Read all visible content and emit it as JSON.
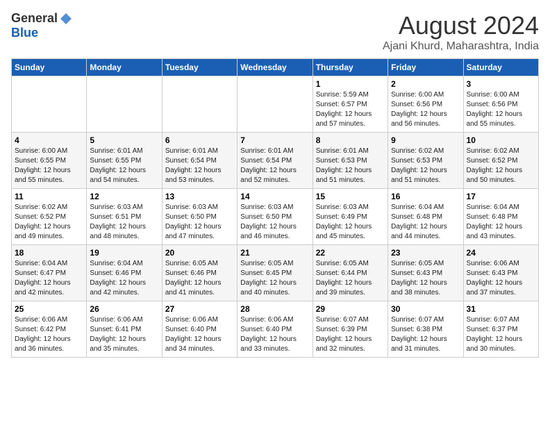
{
  "header": {
    "logo_general": "General",
    "logo_blue": "Blue",
    "month_title": "August 2024",
    "location": "Ajani Khurd, Maharashtra, India"
  },
  "weekdays": [
    "Sunday",
    "Monday",
    "Tuesday",
    "Wednesday",
    "Thursday",
    "Friday",
    "Saturday"
  ],
  "weeks": [
    [
      {
        "day": "",
        "info": ""
      },
      {
        "day": "",
        "info": ""
      },
      {
        "day": "",
        "info": ""
      },
      {
        "day": "",
        "info": ""
      },
      {
        "day": "1",
        "info": "Sunrise: 5:59 AM\nSunset: 6:57 PM\nDaylight: 12 hours\nand 57 minutes."
      },
      {
        "day": "2",
        "info": "Sunrise: 6:00 AM\nSunset: 6:56 PM\nDaylight: 12 hours\nand 56 minutes."
      },
      {
        "day": "3",
        "info": "Sunrise: 6:00 AM\nSunset: 6:56 PM\nDaylight: 12 hours\nand 55 minutes."
      }
    ],
    [
      {
        "day": "4",
        "info": "Sunrise: 6:00 AM\nSunset: 6:55 PM\nDaylight: 12 hours\nand 55 minutes."
      },
      {
        "day": "5",
        "info": "Sunrise: 6:01 AM\nSunset: 6:55 PM\nDaylight: 12 hours\nand 54 minutes."
      },
      {
        "day": "6",
        "info": "Sunrise: 6:01 AM\nSunset: 6:54 PM\nDaylight: 12 hours\nand 53 minutes."
      },
      {
        "day": "7",
        "info": "Sunrise: 6:01 AM\nSunset: 6:54 PM\nDaylight: 12 hours\nand 52 minutes."
      },
      {
        "day": "8",
        "info": "Sunrise: 6:01 AM\nSunset: 6:53 PM\nDaylight: 12 hours\nand 51 minutes."
      },
      {
        "day": "9",
        "info": "Sunrise: 6:02 AM\nSunset: 6:53 PM\nDaylight: 12 hours\nand 51 minutes."
      },
      {
        "day": "10",
        "info": "Sunrise: 6:02 AM\nSunset: 6:52 PM\nDaylight: 12 hours\nand 50 minutes."
      }
    ],
    [
      {
        "day": "11",
        "info": "Sunrise: 6:02 AM\nSunset: 6:52 PM\nDaylight: 12 hours\nand 49 minutes."
      },
      {
        "day": "12",
        "info": "Sunrise: 6:03 AM\nSunset: 6:51 PM\nDaylight: 12 hours\nand 48 minutes."
      },
      {
        "day": "13",
        "info": "Sunrise: 6:03 AM\nSunset: 6:50 PM\nDaylight: 12 hours\nand 47 minutes."
      },
      {
        "day": "14",
        "info": "Sunrise: 6:03 AM\nSunset: 6:50 PM\nDaylight: 12 hours\nand 46 minutes."
      },
      {
        "day": "15",
        "info": "Sunrise: 6:03 AM\nSunset: 6:49 PM\nDaylight: 12 hours\nand 45 minutes."
      },
      {
        "day": "16",
        "info": "Sunrise: 6:04 AM\nSunset: 6:48 PM\nDaylight: 12 hours\nand 44 minutes."
      },
      {
        "day": "17",
        "info": "Sunrise: 6:04 AM\nSunset: 6:48 PM\nDaylight: 12 hours\nand 43 minutes."
      }
    ],
    [
      {
        "day": "18",
        "info": "Sunrise: 6:04 AM\nSunset: 6:47 PM\nDaylight: 12 hours\nand 42 minutes."
      },
      {
        "day": "19",
        "info": "Sunrise: 6:04 AM\nSunset: 6:46 PM\nDaylight: 12 hours\nand 42 minutes."
      },
      {
        "day": "20",
        "info": "Sunrise: 6:05 AM\nSunset: 6:46 PM\nDaylight: 12 hours\nand 41 minutes."
      },
      {
        "day": "21",
        "info": "Sunrise: 6:05 AM\nSunset: 6:45 PM\nDaylight: 12 hours\nand 40 minutes."
      },
      {
        "day": "22",
        "info": "Sunrise: 6:05 AM\nSunset: 6:44 PM\nDaylight: 12 hours\nand 39 minutes."
      },
      {
        "day": "23",
        "info": "Sunrise: 6:05 AM\nSunset: 6:43 PM\nDaylight: 12 hours\nand 38 minutes."
      },
      {
        "day": "24",
        "info": "Sunrise: 6:06 AM\nSunset: 6:43 PM\nDaylight: 12 hours\nand 37 minutes."
      }
    ],
    [
      {
        "day": "25",
        "info": "Sunrise: 6:06 AM\nSunset: 6:42 PM\nDaylight: 12 hours\nand 36 minutes."
      },
      {
        "day": "26",
        "info": "Sunrise: 6:06 AM\nSunset: 6:41 PM\nDaylight: 12 hours\nand 35 minutes."
      },
      {
        "day": "27",
        "info": "Sunrise: 6:06 AM\nSunset: 6:40 PM\nDaylight: 12 hours\nand 34 minutes."
      },
      {
        "day": "28",
        "info": "Sunrise: 6:06 AM\nSunset: 6:40 PM\nDaylight: 12 hours\nand 33 minutes."
      },
      {
        "day": "29",
        "info": "Sunrise: 6:07 AM\nSunset: 6:39 PM\nDaylight: 12 hours\nand 32 minutes."
      },
      {
        "day": "30",
        "info": "Sunrise: 6:07 AM\nSunset: 6:38 PM\nDaylight: 12 hours\nand 31 minutes."
      },
      {
        "day": "31",
        "info": "Sunrise: 6:07 AM\nSunset: 6:37 PM\nDaylight: 12 hours\nand 30 minutes."
      }
    ]
  ]
}
